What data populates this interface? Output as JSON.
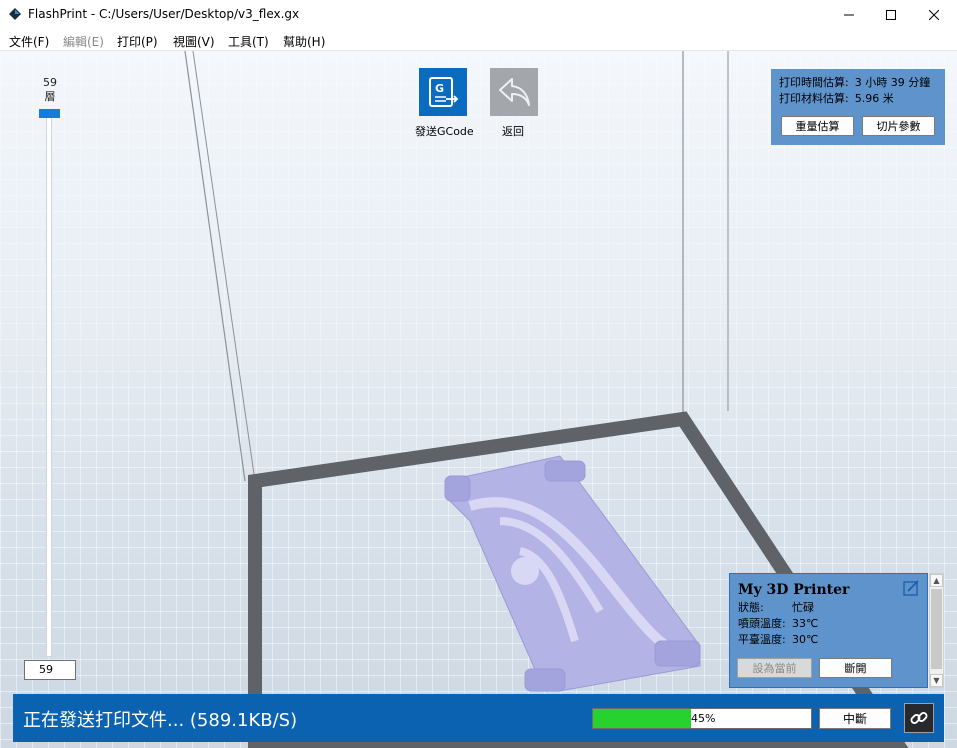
{
  "window": {
    "title": "FlashPrint - C:/Users/User/Desktop/v3_flex.gx"
  },
  "menu": [
    {
      "label": "文件(F)",
      "disabled": false
    },
    {
      "label": "編輯(E)",
      "disabled": true
    },
    {
      "label": "打印(P)",
      "disabled": false
    },
    {
      "label": "視圖(V)",
      "disabled": false
    },
    {
      "label": "工具(T)",
      "disabled": false
    },
    {
      "label": "幫助(H)",
      "disabled": false
    }
  ],
  "layer_slider": {
    "top_value": "59",
    "top_unit": "層",
    "input_value": "59"
  },
  "toolbar": {
    "send_gcode_label": "發送GCode",
    "back_label": "返回"
  },
  "estimate": {
    "time_label": "打印時間估算:",
    "time_value": "3 小時 39 分鐘",
    "material_label": "打印材料估算:",
    "material_value": "5.96 米",
    "weight_button": "重量估算",
    "slice_button": "切片參數"
  },
  "printer": {
    "name": "My 3D Printer",
    "status_label": "狀態:",
    "status_value": "忙碌",
    "nozzle_label": "噴頭溫度:",
    "nozzle_value": "33℃",
    "bed_label": "平臺溫度:",
    "bed_value": "30℃",
    "set_current_button": "設為當前",
    "disconnect_button": "斷開"
  },
  "status_bar": {
    "message": "正在發送打印文件... (589.1KB/S)",
    "progress_percent": 45,
    "progress_label": "45%",
    "abort_button": "中斷"
  },
  "colors": {
    "accent_blue": "#0a62b0",
    "panel_blue": "#5f93cc",
    "progress_green": "#27d12e",
    "model_lavender": "#b3b3e6"
  },
  "icons": {
    "app": "flashprint-diamond-icon",
    "send_gcode": "gcode-send-icon",
    "back": "back-arrow-icon",
    "edit": "edit-icon",
    "link": "link-icon"
  }
}
